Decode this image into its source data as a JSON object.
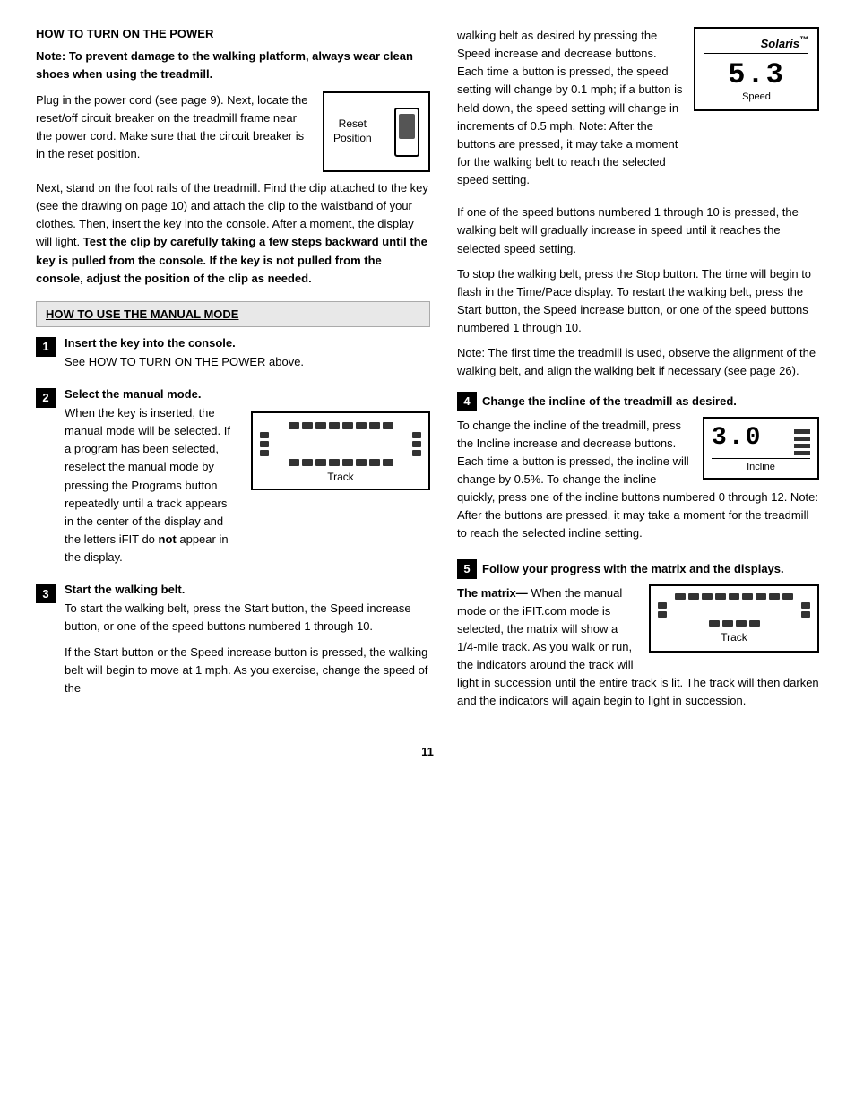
{
  "page": {
    "number": "11"
  },
  "left": {
    "section1_title": "HOW TO TURN ON THE POWER",
    "note_bold": "Note: To prevent damage to the walking platform, always wear clean shoes when using the treadmill.",
    "para1": "Plug in the power cord (see page 9). Next, locate the reset/off circuit breaker on the treadmill frame near the power cord. Make sure that the circuit breaker is in the reset position.",
    "reset_label": "Reset\nPosition",
    "para2": "Next, stand on the foot rails of the treadmill. Find the clip attached to the key (see the drawing on page 10) and attach the clip to the waistband of your clothes. Then, insert the key into the console. After a moment, the display will light.",
    "para2_bold": "Test the clip by carefully taking a few steps backward until the key is pulled from the console. If the key is not pulled from the console, adjust the position of the clip as needed.",
    "manual_section_title": "HOW TO USE THE MANUAL MODE",
    "step1_title": "Insert the key into the console.",
    "step1_text": "See HOW TO TURN ON THE POWER above.",
    "step2_title": "Select the manual mode.",
    "step2_text1": "When the key is inserted, the manual mode will be selected. If a program has been selected, reselect the manual mode by pressing the Programs button repeatedly until a track appears in the center of the display and the letters iFIT do ",
    "step2_not": "not",
    "step2_text2": " appear in the display.",
    "track_label": "Track",
    "step3_title": "Start the walking belt.",
    "step3_text1": "To start the walking belt, press the Start button, the Speed increase button, or one of the speed buttons numbered 1 through 10.",
    "step3_text2": "If the Start button or the Speed increase button is pressed, the walking belt will begin to move at 1 mph. As you exercise, change the speed of the"
  },
  "right": {
    "para1": "walking belt as desired by pressing the Speed increase and decrease buttons. Each time a button is pressed, the speed setting will change by 0.1 mph; if a button is held down, the speed setting will change in increments of 0.5 mph. Note: After the buttons are pressed, it may take a moment for the walking belt to reach the selected speed setting.",
    "solaris_title": "Solaris",
    "solaris_tm": "™",
    "solaris_number": "5.3",
    "solaris_speed": "Speed",
    "para2": "If one of the speed buttons numbered 1 through 10 is pressed, the walking belt will gradually increase in speed until it reaches the selected speed setting.",
    "para3": "To stop the walking belt, press the Stop button. The time will begin to flash in the Time/Pace display. To restart the walking belt, press the Start button, the Speed increase button, or one of the speed buttons numbered 1 through 10.",
    "para4": "Note: The first time the treadmill is used, observe the alignment of the walking belt, and align the walking belt if necessary (see page 26).",
    "step4_title": "Change the incline of the treadmill as desired.",
    "step4_text": "To change the incline of the treadmill, press the Incline increase and decrease buttons. Each time a button is pressed, the incline will change by 0.5%. To change the incline quickly, press one of the incline buttons numbered 0 through 12. Note: After the buttons are pressed, it may take a moment for the treadmill to reach the selected incline setting.",
    "incline_number": "3.0",
    "incline_label": "Incline",
    "step5_title": "Follow your progress with the matrix and the displays.",
    "matrix_title": "The matrix—",
    "matrix_text": "When the manual mode or the iFIT.com mode is selected, the matrix will show a 1/4-mile track. As you walk or run, the indicators around the track will light in succession until the entire track is lit. The track will then darken and the indicators will again begin to light in succession.",
    "track_label": "Track"
  }
}
